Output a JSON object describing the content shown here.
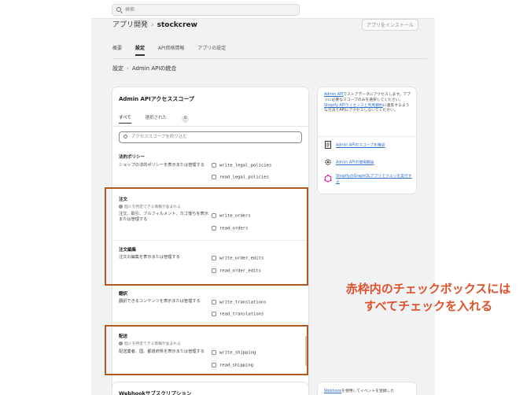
{
  "topbar": {
    "search_placeholder": "検索"
  },
  "header": {
    "breadcrumb_root": "アプリ開発",
    "separator": "›",
    "app_name": "stockcrew",
    "install_button": "アプリをインストール"
  },
  "tabs": [
    {
      "label": "概要"
    },
    {
      "label": "設定",
      "active": true
    },
    {
      "label": "API資格情報"
    },
    {
      "label": "アプリの設定"
    }
  ],
  "crumb": {
    "parent": "設定",
    "current": "Admin APIの統合"
  },
  "card": {
    "title": "Admin APIアクセススコープ",
    "tab_all": "すべて",
    "tab_selected": "選択された",
    "selected_count": "0",
    "search_placeholder": "アクセススコープを絞り込む"
  },
  "sections": {
    "legal": {
      "title": "法的ポリシー",
      "desc": "ショップの法的ポリシーを表示または管理する",
      "scopes": [
        "write_legal_policies",
        "read_legal_policies"
      ]
    },
    "orders": {
      "title": "注文",
      "note": "個人を特定できる情報が含まれる",
      "desc": "注文、取引、フルフィルメント、カゴ落ちを表示または管理する",
      "scopes": [
        "write_orders",
        "read_orders"
      ]
    },
    "order_edits": {
      "title": "注文編集",
      "desc": "注文の編集を表示または管理する",
      "scopes": [
        "write_order_edits",
        "read_order_edits"
      ]
    },
    "translations": {
      "title": "翻訳",
      "desc": "翻訳できるコンテンツを表示または管理する",
      "scopes": [
        "write_translations",
        "read_translations"
      ]
    },
    "shipping": {
      "title": "配送",
      "note": "個人を特定できる情報が含まれる",
      "desc": "配送業者、国、都道府県を表示または管理する",
      "scopes": [
        "write_shipping",
        "read_shipping"
      ]
    }
  },
  "sidebar": {
    "intro_link1": "Admin API",
    "intro_text1": "でストアデータにアクセスします。アプリに必要なスコープのみを選択してください。",
    "intro_link2": "Shopify APIライセンスと利用規約",
    "intro_text2": "に違反するような方法でAPIにアクセスしないでください。",
    "links": [
      {
        "label": "Admin APIのスコープを確認",
        "icon": "document-icon"
      },
      {
        "label": "Admin APIの使用開始",
        "icon": "gear-icon"
      },
      {
        "label": "ShopifyのGraphQLアプリでクエリを実行する",
        "icon": "graphql-icon"
      }
    ]
  },
  "webhook": {
    "title": "Webhookサブスクリプション",
    "side_link": "Webhook",
    "side_text": "を使用してイベントを登録した"
  },
  "annotation": {
    "line1": "赤枠内のチェックボックスには",
    "line2": "すべてチェックを入れる"
  },
  "colors": {
    "highlight": "#b35a1f",
    "annotation": "#e0502a",
    "link": "#2c6ecb"
  }
}
